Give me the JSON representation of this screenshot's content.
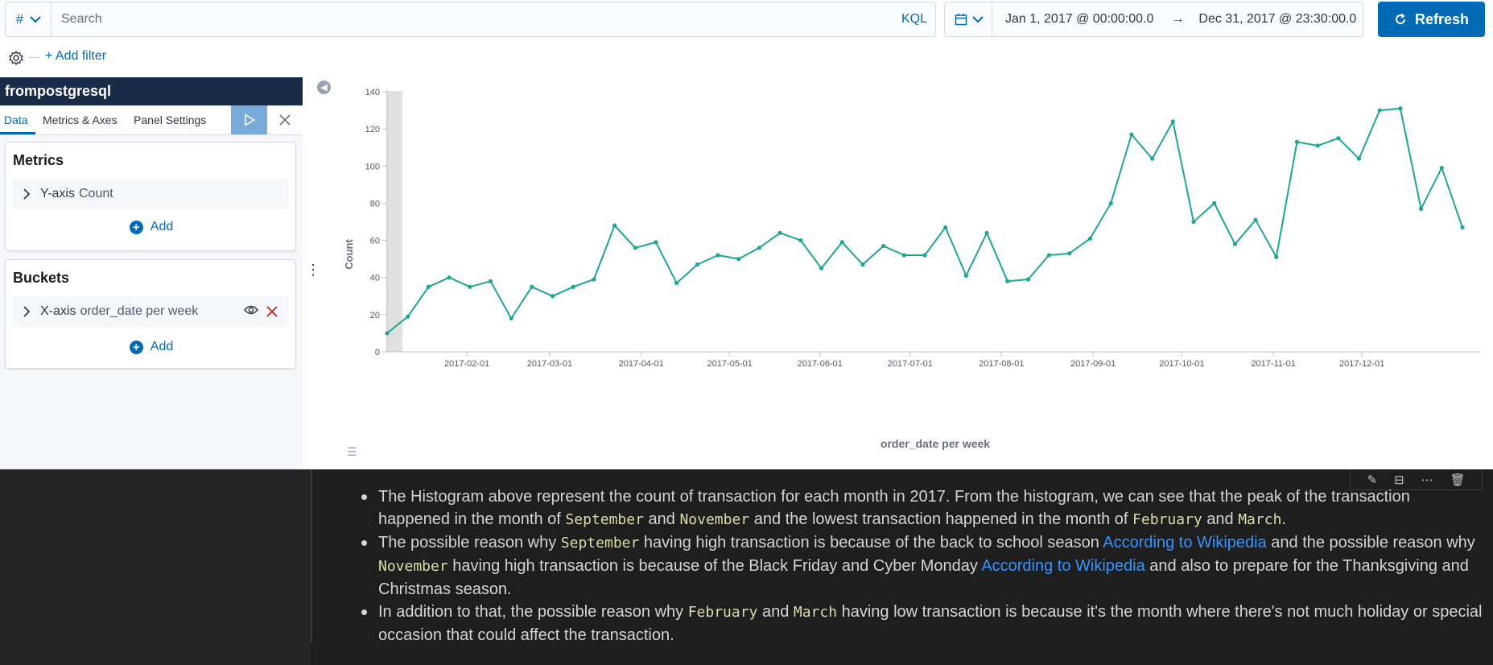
{
  "query_bar": {
    "language_icon": "#",
    "search_placeholder": "Search",
    "kql_label": "KQL",
    "date_start": "Jan 1, 2017 @ 00:00:00.0",
    "date_arrow": "→",
    "date_end": "Dec 31, 2017 @ 23:30:00.0",
    "refresh_label": "Refresh",
    "add_filter_label": "+ Add filter"
  },
  "sidebar": {
    "index_title": "frompostgresql",
    "tabs": [
      "Data",
      "Metrics & Axes",
      "Panel Settings"
    ],
    "metrics": {
      "title": "Metrics",
      "row_axis": "Y-axis",
      "row_value": "Count",
      "add_label": "Add"
    },
    "buckets": {
      "title": "Buckets",
      "row_axis": "X-axis",
      "row_value": "order_date per week",
      "add_label": "Add"
    }
  },
  "chart_data": {
    "type": "line",
    "xlabel": "order_date per week",
    "ylabel": "Count",
    "ylim": [
      0,
      140
    ],
    "y_ticks": [
      0,
      20,
      40,
      60,
      80,
      100,
      120,
      140
    ],
    "x_tick_labels": [
      "2017-02-01",
      "2017-03-01",
      "2017-04-01",
      "2017-05-01",
      "2017-06-01",
      "2017-07-01",
      "2017-08-01",
      "2017-09-01",
      "2017-10-01",
      "2017-11-01",
      "2017-12-01"
    ],
    "x_ticks_week_index": [
      3.86,
      7.86,
      12.29,
      16.57,
      20.93,
      25.29,
      29.71,
      34.14,
      38.43,
      42.86,
      47.14
    ],
    "line_color": "#1ea593",
    "values": [
      10,
      19,
      35,
      40,
      35,
      38,
      18,
      35,
      30,
      35,
      39,
      68,
      56,
      59,
      37,
      47,
      52,
      50,
      56,
      64,
      60,
      45,
      59,
      47,
      57,
      52,
      52,
      67,
      41,
      64,
      38,
      39,
      52,
      53,
      61,
      80,
      117,
      104,
      124,
      70,
      80,
      58,
      71,
      51,
      113,
      111,
      115,
      104,
      130,
      131,
      77,
      99,
      67
    ]
  },
  "notebook": {
    "toolbar_icons": [
      "pencil-icon",
      "split-cell-icon",
      "more-icon",
      "trash-icon"
    ],
    "bullets": [
      {
        "parts": [
          {
            "t": "text",
            "v": "The Histogram above represent the count of transaction for each month in 2017. From the histogram, we can see that the peak of the transaction happened in the month of "
          },
          {
            "t": "code",
            "v": "September"
          },
          {
            "t": "text",
            "v": " and "
          },
          {
            "t": "code",
            "v": "November"
          },
          {
            "t": "text",
            "v": " and the lowest transaction happened in the month of "
          },
          {
            "t": "code",
            "v": "February"
          },
          {
            "t": "text",
            "v": " and "
          },
          {
            "t": "code",
            "v": "March"
          },
          {
            "t": "text",
            "v": "."
          }
        ]
      },
      {
        "parts": [
          {
            "t": "text",
            "v": "The possible reason why "
          },
          {
            "t": "code",
            "v": "September"
          },
          {
            "t": "text",
            "v": " having high transaction is because of the back to school season "
          },
          {
            "t": "link",
            "v": "According to Wikipedia"
          },
          {
            "t": "text",
            "v": " and the possible reason why "
          },
          {
            "t": "code",
            "v": "November"
          },
          {
            "t": "text",
            "v": " having high transaction is because of the Black Friday and Cyber Monday "
          },
          {
            "t": "link",
            "v": "According to Wikipedia"
          },
          {
            "t": "text",
            "v": " and also to prepare for the Thanksgiving and Christmas season."
          }
        ]
      },
      {
        "parts": [
          {
            "t": "text",
            "v": "In addition to that, the possible reason why "
          },
          {
            "t": "code",
            "v": "February"
          },
          {
            "t": "text",
            "v": " and "
          },
          {
            "t": "code",
            "v": "March"
          },
          {
            "t": "text",
            "v": " having low transaction is because it's the month where there's not much holiday or special occasion that could affect the transaction."
          }
        ]
      }
    ]
  }
}
